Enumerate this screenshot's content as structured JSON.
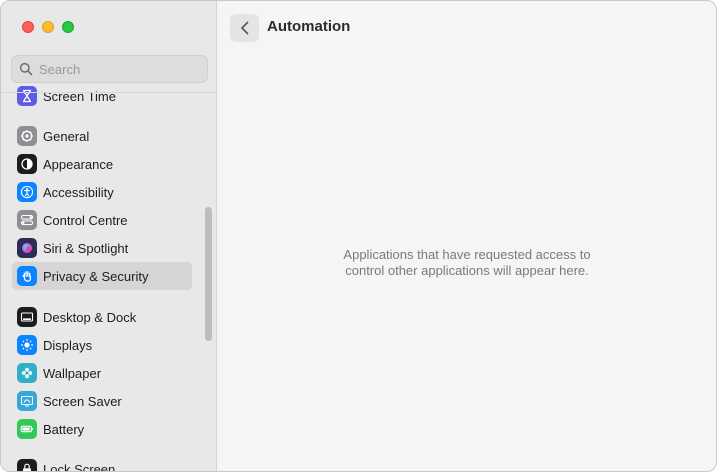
{
  "window": {
    "traffic_lights": [
      "close",
      "minimize",
      "zoom"
    ]
  },
  "search": {
    "placeholder": "Search"
  },
  "sidebar": {
    "items": [
      {
        "label": "Screen Time",
        "icon": "hourglass-icon",
        "color": "#5e5ce6"
      },
      {
        "label": "General",
        "icon": "gear-icon",
        "color": "#8e8e93"
      },
      {
        "label": "Appearance",
        "icon": "appearance-icon",
        "color": "#1c1c1e"
      },
      {
        "label": "Accessibility",
        "icon": "accessibility-icon",
        "color": "#0a84ff"
      },
      {
        "label": "Control Centre",
        "icon": "control-centre-icon",
        "color": "#8e8e93"
      },
      {
        "label": "Siri & Spotlight",
        "icon": "siri-icon",
        "color": "#2c2c54"
      },
      {
        "label": "Privacy & Security",
        "icon": "hand-icon",
        "color": "#0a84ff",
        "selected": true
      },
      {
        "label": "Desktop & Dock",
        "icon": "dock-icon",
        "color": "#1c1c1e"
      },
      {
        "label": "Displays",
        "icon": "sun-icon",
        "color": "#0a84ff"
      },
      {
        "label": "Wallpaper",
        "icon": "flower-icon",
        "color": "#30b0c7"
      },
      {
        "label": "Screen Saver",
        "icon": "screen-saver-icon",
        "color": "#35a7d8"
      },
      {
        "label": "Battery",
        "icon": "battery-icon",
        "color": "#34c759"
      },
      {
        "label": "Lock Screen",
        "icon": "lock-icon",
        "color": "#1c1c1e"
      }
    ]
  },
  "main": {
    "title": "Automation",
    "empty_line_1": "Applications that have requested access to",
    "empty_line_2": "control other applications will appear here."
  }
}
